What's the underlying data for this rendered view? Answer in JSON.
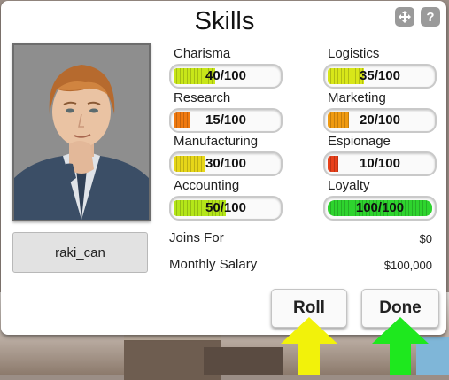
{
  "window": {
    "title": "Skills",
    "move_icon": "move-icon",
    "help_icon": "?"
  },
  "character": {
    "name": "raki_can",
    "portrait": "character-portrait"
  },
  "skills": [
    {
      "label": "Charisma",
      "value": "40/100",
      "level": 40,
      "color": "#c8e619"
    },
    {
      "label": "Logistics",
      "value": "35/100",
      "level": 35,
      "color": "#d8e619"
    },
    {
      "label": "Research",
      "value": "15/100",
      "level": 15,
      "color": "#f07a10"
    },
    {
      "label": "Marketing",
      "value": "20/100",
      "level": 20,
      "color": "#f09a10"
    },
    {
      "label": "Manufacturing",
      "value": "30/100",
      "level": 30,
      "color": "#e6d619"
    },
    {
      "label": "Espionage",
      "value": "10/100",
      "level": 10,
      "color": "#e8401a"
    },
    {
      "label": "Accounting",
      "value": "50/100",
      "level": 50,
      "color": "#b4e619"
    },
    {
      "label": "Loyalty",
      "value": "100/100",
      "level": 100,
      "color": "#2ed42e"
    }
  ],
  "info": {
    "joins_for_label": "Joins For",
    "joins_for_value": "$0",
    "salary_label": "Monthly Salary",
    "salary_value": "$100,000"
  },
  "buttons": {
    "roll": "Roll",
    "done": "Done"
  },
  "colors": {
    "roll_arrow": "#f2f20a",
    "done_arrow": "#1ee81e"
  }
}
